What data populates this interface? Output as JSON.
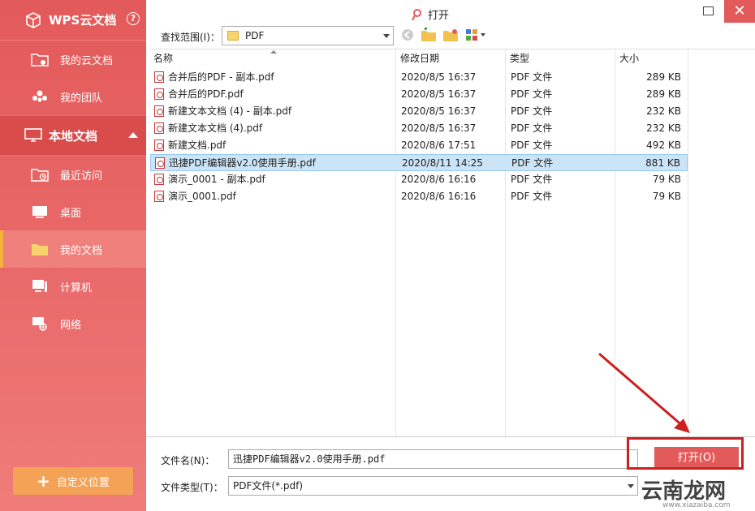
{
  "sidebar": {
    "brand": "WPS云文档",
    "help": "?",
    "cloud_items": [
      {
        "label": "我的云文档"
      },
      {
        "label": "我的团队"
      }
    ],
    "section": "本地文档",
    "local_items": [
      {
        "label": "最近访问"
      },
      {
        "label": "桌面"
      },
      {
        "label": "我的文档"
      },
      {
        "label": "计算机"
      },
      {
        "label": "网络"
      }
    ],
    "active_item": "我的文档",
    "custom_location": "自定义位置"
  },
  "dialog": {
    "title": "打开",
    "lookin_label": "查找范围(I)：",
    "lookin_value": "PDF",
    "close_glyph": "✕"
  },
  "columns": {
    "name": "名称",
    "modified": "修改日期",
    "type": "类型",
    "size": "大小"
  },
  "files": [
    {
      "name": "合并后的PDF - 副本.pdf",
      "modified": "2020/8/5 16:37",
      "type": "PDF 文件",
      "size": "289 KB"
    },
    {
      "name": "合并后的PDF.pdf",
      "modified": "2020/8/5 16:37",
      "type": "PDF 文件",
      "size": "289 KB"
    },
    {
      "name": "新建文本文档 (4) - 副本.pdf",
      "modified": "2020/8/5 16:37",
      "type": "PDF 文件",
      "size": "232 KB"
    },
    {
      "name": "新建文本文档 (4).pdf",
      "modified": "2020/8/5 16:37",
      "type": "PDF 文件",
      "size": "232 KB"
    },
    {
      "name": "新建文档.pdf",
      "modified": "2020/8/6 17:51",
      "type": "PDF 文件",
      "size": "492 KB"
    },
    {
      "name": "迅捷PDF编辑器v2.0使用手册.pdf",
      "modified": "2020/8/11 14:25",
      "type": "PDF 文件",
      "size": "881 KB",
      "selected": true
    },
    {
      "name": "演示_0001 - 副本.pdf",
      "modified": "2020/8/6 16:16",
      "type": "PDF 文件",
      "size": "79 KB"
    },
    {
      "name": "演示_0001.pdf",
      "modified": "2020/8/6 16:16",
      "type": "PDF 文件",
      "size": "79 KB"
    }
  ],
  "footer": {
    "filename_label": "文件名(N)：",
    "filename_value": "迅捷PDF编辑器v2.0使用手册.pdf",
    "filetype_label": "文件类型(T)：",
    "filetype_value": "PDF文件(*.pdf)",
    "open_button": "打开(O)"
  },
  "watermark": {
    "text": "云南龙网",
    "sub": "www.xiazaiba.com"
  },
  "colors": {
    "accent": "#e35a5a",
    "sidebar_active": "#f0807c",
    "indicator": "#f7b23b",
    "custom_button": "#f4a256",
    "selection": "#cce4f7",
    "annotation": "#cc1f1f"
  }
}
